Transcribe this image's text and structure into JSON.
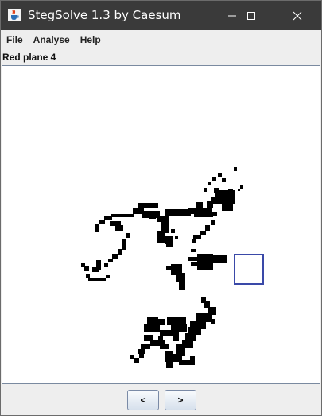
{
  "window": {
    "title": "StegSolve 1.3 by Caesum",
    "icon": "java-cup-icon",
    "controls": [
      "minimize-icon",
      "maximize-icon",
      "close-icon"
    ]
  },
  "menu": {
    "items": [
      "File",
      "Analyse",
      "Help"
    ]
  },
  "plane": {
    "label": "Red plane 4"
  },
  "navigation": {
    "prev_label": "<",
    "next_label": ">"
  },
  "colors": {
    "titlebar": "#3a3a3a",
    "selection_box": "#3a49a8",
    "pixel": "#000000",
    "panel_bg": "#ffffff"
  }
}
